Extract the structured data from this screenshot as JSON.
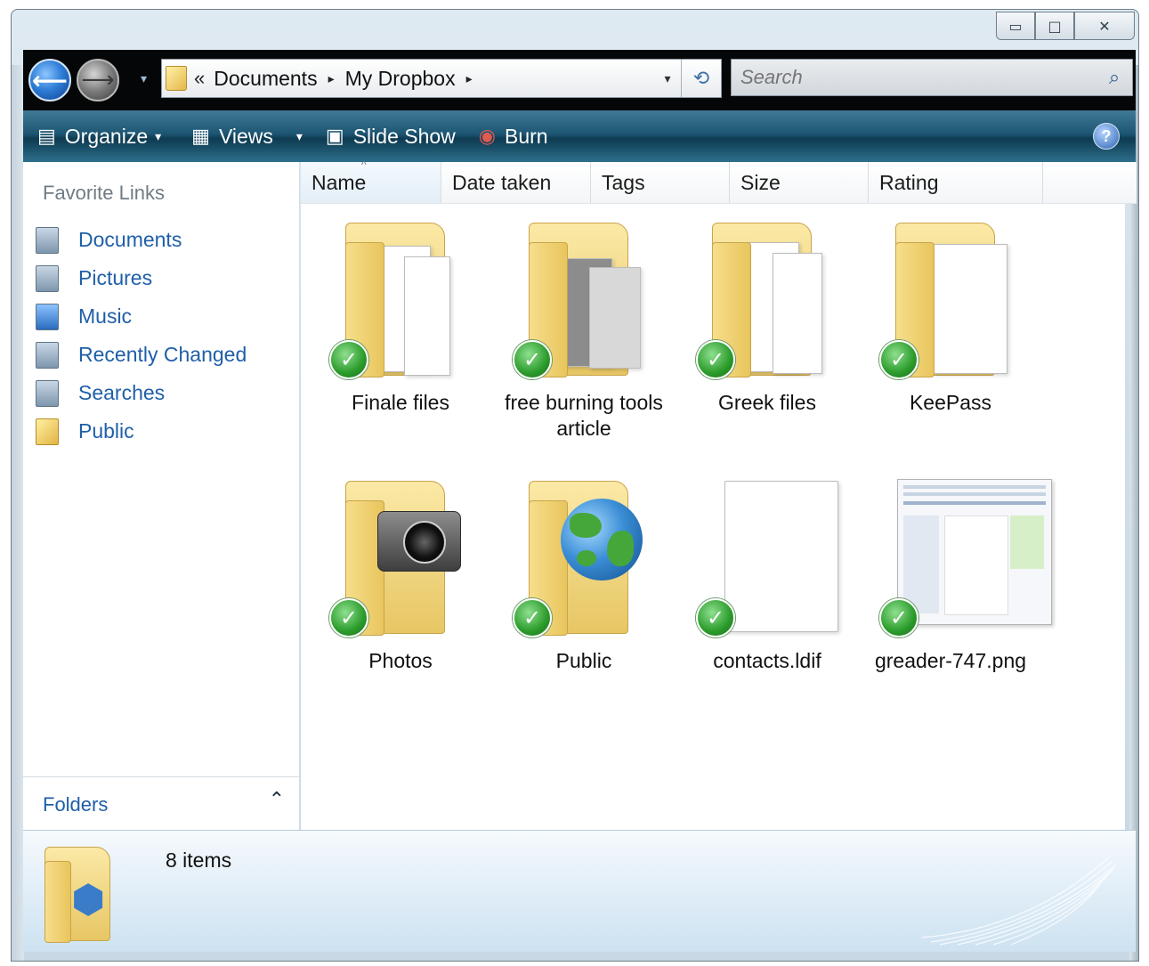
{
  "window": {
    "caption_buttons": [
      {
        "name": "minimize-button",
        "glyph": "▭"
      },
      {
        "name": "maximize-button",
        "glyph": "□"
      },
      {
        "name": "close-button",
        "glyph": "✕"
      }
    ]
  },
  "navigation": {
    "back_glyph": "⟵",
    "forward_glyph": "⟶",
    "recent_glyph": "▾",
    "breadcrumb_prefix": "«",
    "breadcrumbs": [
      "Documents",
      "My Dropbox"
    ],
    "separator": "▸",
    "dropdown_glyph": "▾",
    "refresh_glyph": "⟲",
    "search_placeholder": "Search",
    "search_icon": "⌕"
  },
  "toolbar": {
    "organize": "Organize",
    "views": "Views",
    "slideshow": "Slide Show",
    "burn": "Burn",
    "caret": "▾",
    "help": "?",
    "icons": {
      "organize": "▤",
      "views": "▦",
      "slideshow": "▣",
      "burn": "◉"
    }
  },
  "sidebar": {
    "title": "Favorite Links",
    "items": [
      {
        "label": "Documents",
        "icon": "documents-icon"
      },
      {
        "label": "Pictures",
        "icon": "pictures-icon"
      },
      {
        "label": "Music",
        "icon": "music-icon"
      },
      {
        "label": "Recently Changed",
        "icon": "recently-changed-icon"
      },
      {
        "label": "Searches",
        "icon": "searches-icon"
      },
      {
        "label": "Public",
        "icon": "public-folder-icon"
      }
    ],
    "folders_label": "Folders",
    "folders_caret": "⌃"
  },
  "columns": [
    "Name",
    "Date taken",
    "Tags",
    "Size",
    "Rating"
  ],
  "sort_indicator": "^",
  "items": [
    {
      "name": "Finale files",
      "type": "folder-docs"
    },
    {
      "name": "free burning tools article",
      "type": "folder-screens"
    },
    {
      "name": "Greek files",
      "type": "folder-docs"
    },
    {
      "name": "KeePass",
      "type": "folder-doc"
    },
    {
      "name": "Photos",
      "type": "folder-camera"
    },
    {
      "name": "Public",
      "type": "folder-globe"
    },
    {
      "name": "contacts.ldif",
      "type": "file"
    },
    {
      "name": "greader-747.png",
      "type": "image"
    }
  ],
  "sync_glyph": "✓",
  "details": {
    "count_text": "8 items",
    "logo_glyph": "⬢"
  },
  "colors": {
    "link": "#1f5fa8",
    "toolbar": "#1d5673",
    "sync_check": "#2a9b2a"
  }
}
